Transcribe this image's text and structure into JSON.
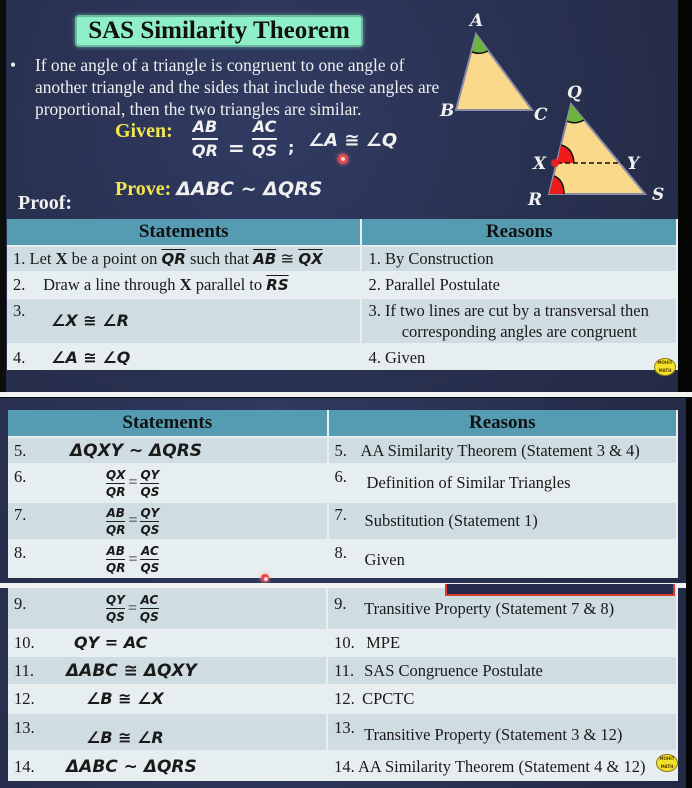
{
  "slide1": {
    "title": "SAS Similarity Theorem",
    "bullet_symbol": "•",
    "bullet_text": "If one angle of a triangle is congruent to one angle of another triangle and the sides that include these angles are proportional, then the two triangles are similar.",
    "given_label": "Given:",
    "given_frac1": {
      "num": "AB",
      "den": "QR"
    },
    "given_equals": "=",
    "given_frac2": {
      "num": "AC",
      "den": "QS"
    },
    "given_separator": ";",
    "given_angle": "∠A ≅ ∠Q",
    "prove_label": "Prove:",
    "prove_statement": "ΔABC ~ ΔQRS",
    "proof_label": "Proof:",
    "diagram": {
      "triangle1_labels": [
        "A",
        "B",
        "C"
      ],
      "triangle2_labels": [
        "Q",
        "R",
        "S",
        "X",
        "Y"
      ],
      "fill_color": "#fbd98a",
      "edge_color": "#8c8ca8",
      "green_angle_color": "#6db33f",
      "red_angle_color": "#f01c1c"
    },
    "table": {
      "headers": {
        "statements": "Statements",
        "reasons": "Reasons"
      },
      "rows": [
        {
          "n": "1.",
          "statement_parts": [
            "Let ",
            "X",
            " be a point on ",
            "QR",
            " such that ",
            "AB",
            " ≅ ",
            "QX"
          ],
          "reason": "1.  By Construction"
        },
        {
          "n": "2.",
          "statement_parts": [
            "Draw a line through ",
            "X",
            " parallel to ",
            "RS"
          ],
          "reason": "2.  Parallel Postulate"
        },
        {
          "n": "3.",
          "statement": "∠X ≅ ∠R",
          "reason_line1": "3. If two lines are cut by a transversal then",
          "reason_line2": "corresponding angles are congruent"
        },
        {
          "n": "4.",
          "statement": "∠A ≅ ∠Q",
          "reason": "4.  Given"
        }
      ]
    },
    "logo_text": "MOHIT MATH"
  },
  "slide2": {
    "table": {
      "headers": {
        "statements": "Statements",
        "reasons": "Reasons"
      },
      "rows": [
        {
          "n": "5.",
          "statement": "ΔQXY ~ ΔQRS",
          "rn": "5.",
          "reason": "AA Similarity Theorem (Statement 3 & 4)"
        },
        {
          "n": "6.",
          "frac1": {
            "num": "QX",
            "den": "QR"
          },
          "frac2": {
            "num": "QY",
            "den": "QS"
          },
          "rn": "6.",
          "reason": "Definition of Similar Triangles"
        },
        {
          "n": "7.",
          "frac1": {
            "num": "AB",
            "den": "QR"
          },
          "frac2": {
            "num": "QY",
            "den": "QS"
          },
          "rn": "7.",
          "reason": "Substitution (Statement 1)"
        },
        {
          "n": "8.",
          "frac1": {
            "num": "AB",
            "den": "QR"
          },
          "frac2": {
            "num": "AC",
            "den": "QS"
          },
          "rn": "8.",
          "reason": "Given"
        }
      ]
    }
  },
  "slide3": {
    "table": {
      "rows": [
        {
          "n": "9.",
          "frac1": {
            "num": "QY",
            "den": "QS"
          },
          "frac2": {
            "num": "AC",
            "den": "QS"
          },
          "rn": "9.",
          "reason": "Transitive Property (Statement 7 & 8)"
        },
        {
          "n": "10.",
          "statement": "QY = AC",
          "rn": "10.",
          "reason": "MPE"
        },
        {
          "n": "11.",
          "statement": "ΔABC ≅ ΔQXY",
          "rn": "11.",
          "reason": "SAS Congruence Postulate"
        },
        {
          "n": "12.",
          "statement": "∠B ≅ ∠X",
          "rn": "12.",
          "reason": "CPCTC"
        },
        {
          "n": "13.",
          "statement": "∠B ≅ ∠R",
          "rn": "13.",
          "reason": "Transitive Property (Statement 3 & 12)"
        },
        {
          "n": "14.",
          "statement": "ΔABC ~ ΔQRS",
          "rn": "14.",
          "reason": "AA Similarity Theorem (Statement 4 & 12)"
        }
      ]
    },
    "logo_text": "MOHIT MATH"
  }
}
